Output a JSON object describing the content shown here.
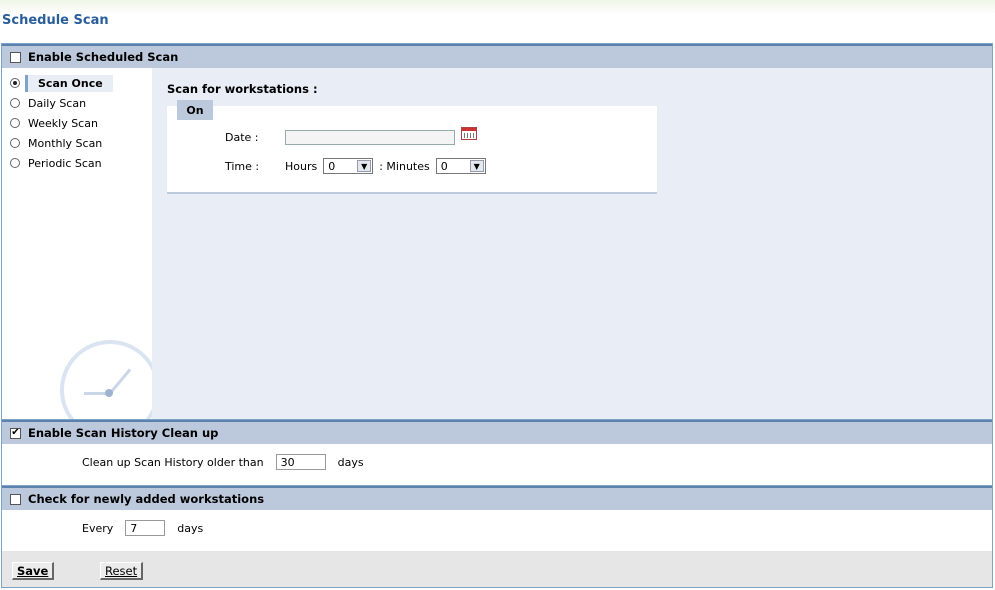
{
  "page": {
    "title": "Schedule Scan"
  },
  "scheduled": {
    "header": "Enable Scheduled Scan",
    "enabled": false,
    "options": [
      {
        "label": "Scan Once",
        "selected": true
      },
      {
        "label": "Daily Scan",
        "selected": false
      },
      {
        "label": "Weekly Scan",
        "selected": false
      },
      {
        "label": "Monthly Scan",
        "selected": false
      },
      {
        "label": "Periodic Scan",
        "selected": false
      }
    ],
    "content_title": "Scan for workstations :",
    "tab_label": "On",
    "date_label": "Date :",
    "date_value": "",
    "time_label": "Time :",
    "hours_label": "Hours",
    "hours_value": "0",
    "minutes_label": ": Minutes",
    "minutes_value": "0"
  },
  "history": {
    "header": "Enable Scan History Clean up",
    "enabled": true,
    "label": "Clean up Scan History older than",
    "value": "30",
    "unit": "days"
  },
  "workstations": {
    "header": "Check for newly added workstations",
    "enabled": false,
    "label": "Every",
    "value": "7",
    "unit": "days"
  },
  "footer": {
    "save_label": "Save",
    "reset_label": "Reset"
  },
  "colors": {
    "title": "#2a5e9a",
    "header_bg": "#bcc9dc",
    "body_bg": "#e8edf6",
    "border": "#7fa3c6"
  }
}
